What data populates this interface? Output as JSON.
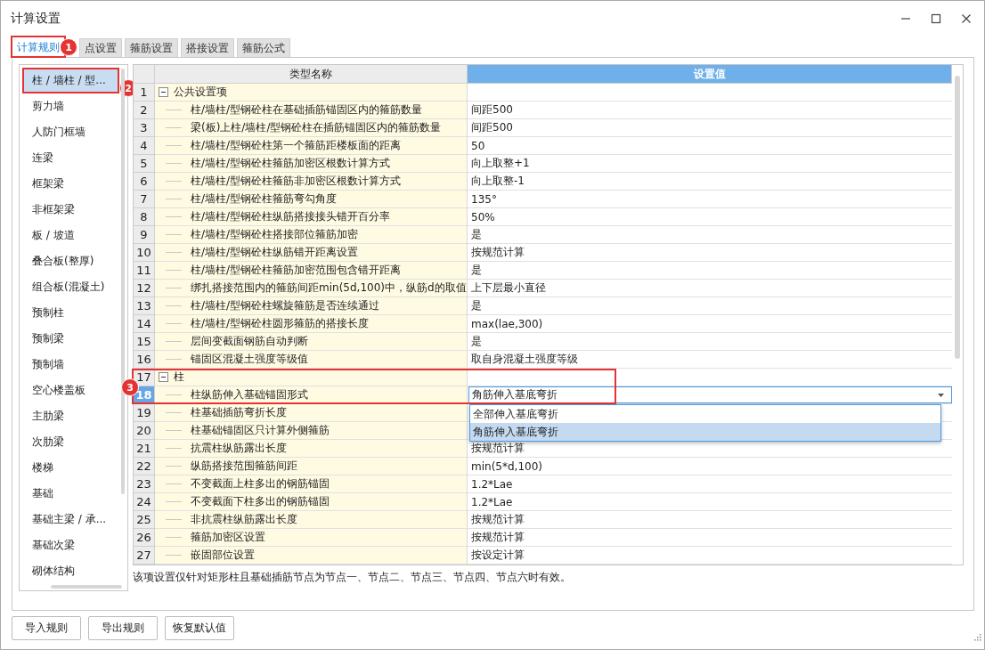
{
  "window": {
    "title": "计算设置"
  },
  "tabs": [
    {
      "label": "计算规则",
      "selected": true,
      "callout": "1"
    },
    {
      "label": "点设置",
      "selected": false
    },
    {
      "label": "箍筋设置",
      "selected": false
    },
    {
      "label": "搭接设置",
      "selected": false
    },
    {
      "label": "箍筋公式",
      "selected": false
    }
  ],
  "sidebar": {
    "items": [
      {
        "label": "柱 / 墙柱 / 型...",
        "selected": true,
        "callout": "2"
      },
      {
        "label": "剪力墙",
        "selected": false
      },
      {
        "label": "人防门框墙",
        "selected": false
      },
      {
        "label": "连梁",
        "selected": false
      },
      {
        "label": "框架梁",
        "selected": false
      },
      {
        "label": "非框架梁",
        "selected": false
      },
      {
        "label": "板 / 坡道",
        "selected": false
      },
      {
        "label": "叠合板(整厚)",
        "selected": false
      },
      {
        "label": "组合板(混凝土)",
        "selected": false
      },
      {
        "label": "预制柱",
        "selected": false
      },
      {
        "label": "预制梁",
        "selected": false
      },
      {
        "label": "预制墙",
        "selected": false
      },
      {
        "label": "空心楼盖板",
        "selected": false
      },
      {
        "label": "主肋梁",
        "selected": false
      },
      {
        "label": "次肋梁",
        "selected": false
      },
      {
        "label": "楼梯",
        "selected": false
      },
      {
        "label": "基础",
        "selected": false
      },
      {
        "label": "基础主梁 / 承...",
        "selected": false
      },
      {
        "label": "基础次梁",
        "selected": false
      },
      {
        "label": "砌体结构",
        "selected": false
      }
    ]
  },
  "table": {
    "columns": [
      "类型名称",
      "设置值"
    ],
    "highlight_callout": "3",
    "rows": [
      {
        "num": "1",
        "kind": "group",
        "name": "公共设置项",
        "expanded": true,
        "selected": false,
        "highlighted": false
      },
      {
        "num": "2",
        "kind": "item",
        "name": "柱/墙柱/型钢砼柱在基础插筋锚固区内的箍筋数量",
        "value": "间距500",
        "selected": false,
        "highlighted": false
      },
      {
        "num": "3",
        "kind": "item",
        "name": "梁(板)上柱/墙柱/型钢砼柱在插筋锚固区内的箍筋数量",
        "value": "间距500",
        "selected": false,
        "highlighted": false
      },
      {
        "num": "4",
        "kind": "item",
        "name": "柱/墙柱/型钢砼柱第一个箍筋距楼板面的距离",
        "value": "50",
        "selected": false,
        "highlighted": false
      },
      {
        "num": "5",
        "kind": "item",
        "name": "柱/墙柱/型钢砼柱箍筋加密区根数计算方式",
        "value": "向上取整+1",
        "selected": false,
        "highlighted": false
      },
      {
        "num": "6",
        "kind": "item",
        "name": "柱/墙柱/型钢砼柱箍筋非加密区根数计算方式",
        "value": "向上取整-1",
        "selected": false,
        "highlighted": false
      },
      {
        "num": "7",
        "kind": "item",
        "name": "柱/墙柱/型钢砼柱箍筋弯勾角度",
        "value": "135°",
        "selected": false,
        "highlighted": false
      },
      {
        "num": "8",
        "kind": "item",
        "name": "柱/墙柱/型钢砼柱纵筋搭接接头错开百分率",
        "value": "50%",
        "selected": false,
        "highlighted": false
      },
      {
        "num": "9",
        "kind": "item",
        "name": "柱/墙柱/型钢砼柱搭接部位箍筋加密",
        "value": "是",
        "selected": false,
        "highlighted": false
      },
      {
        "num": "10",
        "kind": "item",
        "name": "柱/墙柱/型钢砼柱纵筋错开距离设置",
        "value": "按规范计算",
        "selected": false,
        "highlighted": false
      },
      {
        "num": "11",
        "kind": "item",
        "name": "柱/墙柱/型钢砼柱箍筋加密范围包含错开距离",
        "value": "是",
        "selected": false,
        "highlighted": false
      },
      {
        "num": "12",
        "kind": "item",
        "name": "绑扎搭接范围内的箍筋间距min(5d,100)中，纵筋d的取值",
        "value": "上下层最小直径",
        "selected": false,
        "highlighted": false
      },
      {
        "num": "13",
        "kind": "item",
        "name": "柱/墙柱/型钢砼柱螺旋箍筋是否连续通过",
        "value": "是",
        "selected": false,
        "highlighted": false
      },
      {
        "num": "14",
        "kind": "item",
        "name": "柱/墙柱/型钢砼柱圆形箍筋的搭接长度",
        "value": "max(lae,300)",
        "selected": false,
        "highlighted": false
      },
      {
        "num": "15",
        "kind": "item",
        "name": "层间变截面钢筋自动判断",
        "value": "是",
        "selected": false,
        "highlighted": false
      },
      {
        "num": "16",
        "kind": "item",
        "name": "锚固区混凝土强度等级值",
        "value": "取自身混凝土强度等级",
        "selected": false,
        "highlighted": false
      },
      {
        "num": "17",
        "kind": "group",
        "name": "柱",
        "expanded": true,
        "selected": false,
        "highlighted": true
      },
      {
        "num": "18",
        "kind": "dropdown",
        "name": "柱纵筋伸入基础锚固形式",
        "value": "角筋伸入基底弯折",
        "selected": true,
        "highlighted": true,
        "options": [
          {
            "label": "全部伸入基底弯折",
            "selected": false
          },
          {
            "label": "角筋伸入基底弯折",
            "selected": true
          }
        ]
      },
      {
        "num": "19",
        "kind": "item",
        "name": "柱基础插筋弯折长度",
        "selected": false,
        "highlighted": false
      },
      {
        "num": "20",
        "kind": "item",
        "name": "柱基础锚固区只计算外侧箍筋",
        "selected": false,
        "highlighted": false
      },
      {
        "num": "21",
        "kind": "item",
        "name": "抗震柱纵筋露出长度",
        "value": "按规范计算",
        "selected": false,
        "highlighted": false
      },
      {
        "num": "22",
        "kind": "item",
        "name": "纵筋搭接范围箍筋间距",
        "value": "min(5*d,100)",
        "selected": false,
        "highlighted": false
      },
      {
        "num": "23",
        "kind": "item",
        "name": "不变截面上柱多出的钢筋锚固",
        "value": "1.2*Lae",
        "selected": false,
        "highlighted": false
      },
      {
        "num": "24",
        "kind": "item",
        "name": "不变截面下柱多出的钢筋锚固",
        "value": "1.2*Lae",
        "selected": false,
        "highlighted": false
      },
      {
        "num": "25",
        "kind": "item",
        "name": "非抗震柱纵筋露出长度",
        "value": "按规范计算",
        "selected": false,
        "highlighted": false
      },
      {
        "num": "26",
        "kind": "item",
        "name": "箍筋加密区设置",
        "value": "按规范计算",
        "selected": false,
        "highlighted": false
      },
      {
        "num": "27",
        "kind": "item",
        "name": "嵌固部位设置",
        "value": "按设定计算",
        "selected": false,
        "highlighted": false
      }
    ]
  },
  "note": "该项设置仅针对矩形柱且基础插筋节点为节点一、节点二、节点三、节点四、节点六时有效。",
  "buttons": [
    "导入规则",
    "导出规则",
    "恢复默认值"
  ]
}
